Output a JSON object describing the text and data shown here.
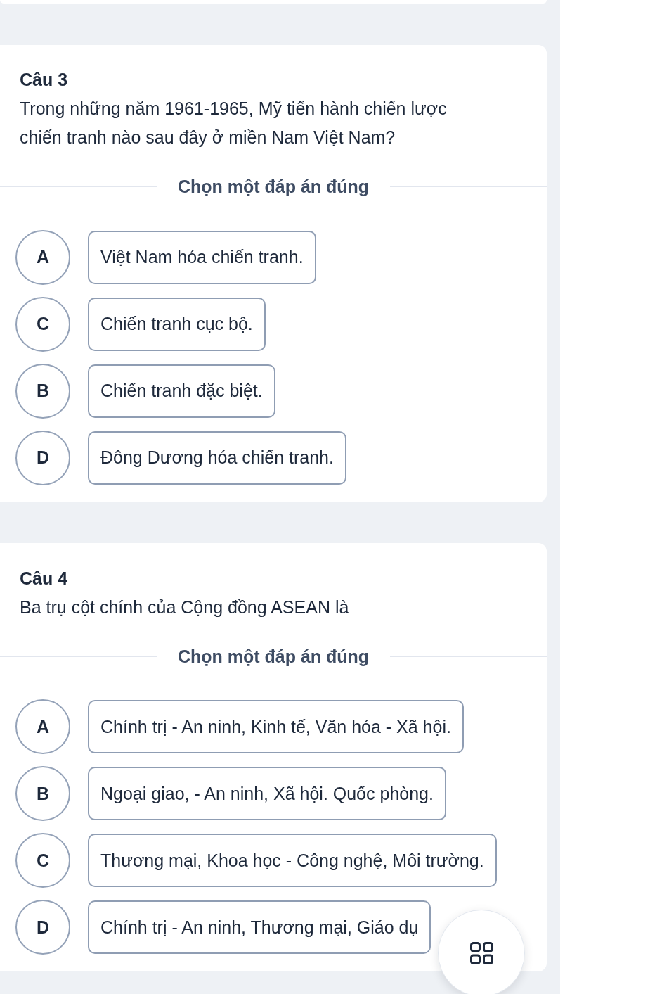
{
  "questions": [
    {
      "title": "Câu 3",
      "text": "Trong những năm 1961-1965, Mỹ tiến hành chiến lược chiến tranh nào sau đây ở miền Nam Việt Nam?",
      "instruction": "Chọn một đáp án đúng",
      "options": [
        {
          "letter": "A",
          "text": "Việt Nam hóa chiến tranh.",
          "selected": false
        },
        {
          "letter": "C",
          "text": "Chiến tranh cục bộ.",
          "selected": false
        },
        {
          "letter": "B",
          "text": "Chiến tranh đặc biệt.",
          "selected": false
        },
        {
          "letter": "D",
          "text": "Đông Dương hóa chiến tranh.",
          "selected": false
        }
      ]
    },
    {
      "title": "Câu 4",
      "text": "Ba trụ cột chính của Cộng đồng ASEAN là",
      "instruction": "Chọn một đáp án đúng",
      "options": [
        {
          "letter": "A",
          "text": "Chính trị - An ninh, Kinh tế, Văn hóa - Xã hội.",
          "selected": false
        },
        {
          "letter": "B",
          "text": "Ngoại giao, - An ninh, Xã hội. Quốc phòng.",
          "selected": false
        },
        {
          "letter": "C",
          "text": "Thương mại, Khoa học - Công nghệ, Môi trường.",
          "selected": false
        },
        {
          "letter": "D",
          "text": "Chính trị - An ninh, Thương mại, Giáo dụ",
          "selected": false
        }
      ]
    }
  ]
}
